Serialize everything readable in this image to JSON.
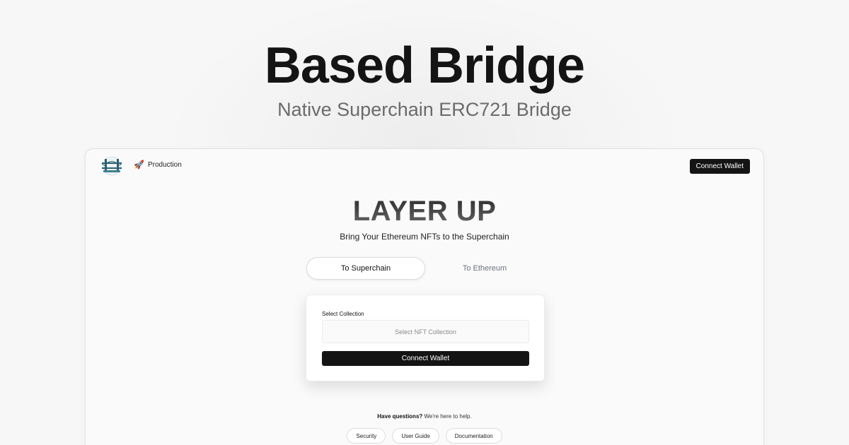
{
  "hero": {
    "title": "Based Bridge",
    "subtitle": "Native Superchain ERC721 Bridge"
  },
  "app": {
    "header": {
      "logo_icon": "bridge-logo-icon",
      "environment_icon": "rocket-icon",
      "environment_label": "Production",
      "connect_label": "Connect Wallet"
    },
    "main": {
      "title": "LAYER UP",
      "subtitle": "Bring Your Ethereum NFTs to the Superchain",
      "tabs": [
        {
          "label": "To Superchain",
          "active": true
        },
        {
          "label": "To Ethereum",
          "active": false
        }
      ],
      "card": {
        "collection_label": "Select Collection",
        "collection_placeholder": "Select NFT Collection",
        "connect_label": "Connect Wallet"
      }
    },
    "help": {
      "question": "Have questions?",
      "tagline": "We're here to help.",
      "links": [
        "Security",
        "User Guide",
        "Documentation"
      ]
    }
  },
  "colors": {
    "primary": "#141414",
    "background": "#f7f7f7",
    "muted_text": "#6b6b6b",
    "bridge_teal": "#2b5f72"
  }
}
